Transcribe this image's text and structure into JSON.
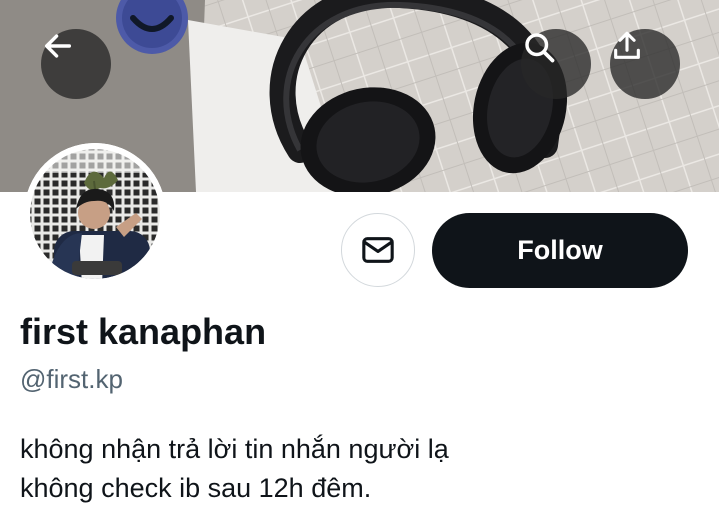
{
  "profile": {
    "display_name": "first kanaphan",
    "handle": "@first.kp",
    "bio_lines": [
      "không nhận trả lời tin nhắn người lạ",
      "không check ib sau 12h đêm."
    ]
  },
  "actions": {
    "follow_label": "Follow"
  },
  "icons": {
    "back": "arrow-left-icon",
    "search": "search-icon",
    "share": "share-icon",
    "message": "envelope-icon"
  },
  "colors": {
    "follow_bg": "#0f1419",
    "follow_text": "#ffffff",
    "primary_text": "#0f1419",
    "secondary_text": "#536471",
    "border": "#d3d8dc",
    "overlay_button": "#282828"
  }
}
